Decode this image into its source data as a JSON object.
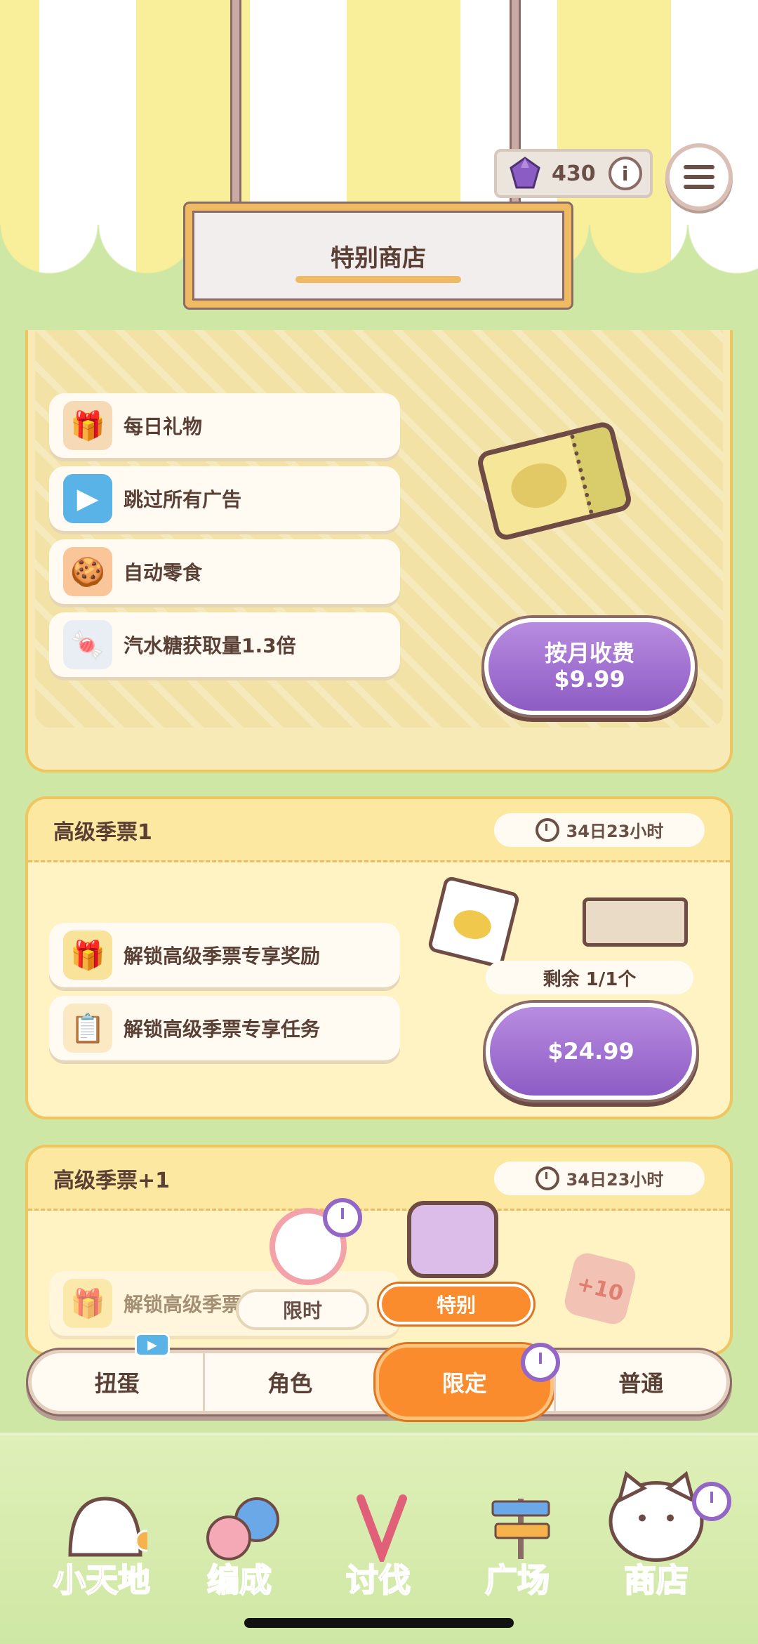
{
  "header": {
    "title": "特别商店",
    "gem_count": "430",
    "info_label": "i"
  },
  "subscription": {
    "features": [
      {
        "label": "每日礼物",
        "icon": "gift-calendar-icon"
      },
      {
        "label": "跳过所有广告",
        "icon": "no-ads-icon"
      },
      {
        "label": "自动零食",
        "icon": "auto-snack-icon"
      },
      {
        "label": "汽水糖获取量1.3倍",
        "icon": "candy-boost-icon"
      }
    ],
    "button_line1": "按月收费",
    "button_line2": "$9.99"
  },
  "pass1": {
    "title": "高级季票1",
    "timer": "34日23小时",
    "features": [
      {
        "label": "解锁高级季票专享奖励",
        "icon": "locked-gift-icon"
      },
      {
        "label": "解锁高级季票专享任务",
        "icon": "locked-task-icon"
      }
    ],
    "remaining": "剩余 1/1个",
    "price": "$24.99"
  },
  "pass2": {
    "title": "高级季票+1",
    "timer": "34日23小时",
    "feature_partial": "解锁高级季票",
    "star_badge": "+10"
  },
  "filter_tags": {
    "limited": "限时",
    "special": "特别"
  },
  "tabs": [
    {
      "label": "扭蛋"
    },
    {
      "label": "角色"
    },
    {
      "label": "限定",
      "active": true
    },
    {
      "label": "普通"
    }
  ],
  "bottom_nav": [
    {
      "label": "小天地",
      "color": "#f08a4b"
    },
    {
      "label": "编成",
      "color": "#5a9ee0"
    },
    {
      "label": "讨伐",
      "color": "#e0607a"
    },
    {
      "label": "广场",
      "color": "#e89a3c"
    },
    {
      "label": "商店",
      "color": "#8a5cc4"
    }
  ],
  "colors": {
    "accent_orange": "#fb8c2e",
    "accent_purple": "#9466c6",
    "card_border": "#efc560"
  }
}
